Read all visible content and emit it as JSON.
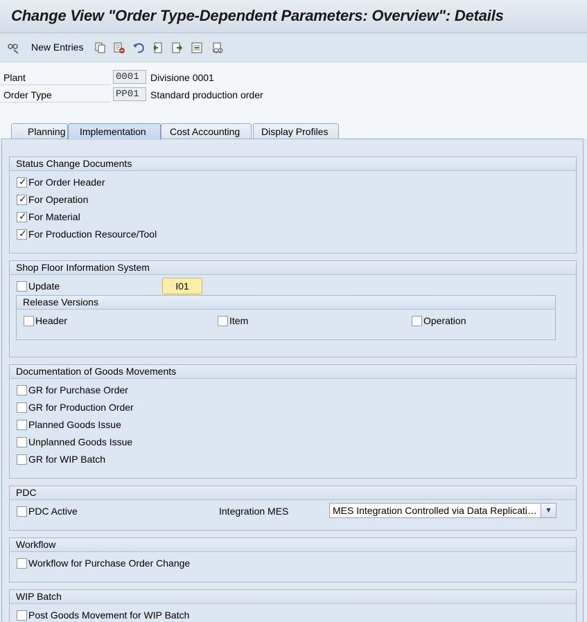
{
  "window": {
    "title": "Change View \"Order Type-Dependent Parameters: Overview\": Details"
  },
  "toolbar": {
    "new_entries_label": "New Entries",
    "icons": [
      "display-change-icon",
      "copy-icon",
      "delete-icon",
      "undo-icon",
      "previous-entry-icon",
      "next-entry-icon",
      "select-block-icon",
      "other-entry-icon"
    ]
  },
  "header": {
    "plant_label": "Plant",
    "plant_value": "0001",
    "plant_desc": "Divisione 0001",
    "order_type_label": "Order Type",
    "order_type_value": "PP01",
    "order_type_desc": "Standard production order"
  },
  "tabs": [
    {
      "label": "Planning",
      "active": false
    },
    {
      "label": "Implementation",
      "active": true
    },
    {
      "label": "Cost Accounting",
      "active": false
    },
    {
      "label": "Display Profiles",
      "active": false
    }
  ],
  "status_change": {
    "title": "Status Change Documents",
    "items": [
      {
        "label": "For Order Header",
        "checked": true
      },
      {
        "label": "For Operation",
        "checked": true
      },
      {
        "label": "For Material",
        "checked": true
      },
      {
        "label": "For Production Resource/Tool",
        "checked": true
      }
    ]
  },
  "shop_floor": {
    "title": "Shop Floor Information System",
    "update_label": "Update",
    "update_checked": false,
    "button_label": "I01",
    "release_versions": {
      "title": "Release Versions",
      "header_label": "Header",
      "item_label": "Item",
      "operation_label": "Operation"
    }
  },
  "goods_movements": {
    "title": "Documentation of Goods Movements",
    "items": [
      {
        "label": "GR for Purchase Order",
        "checked": false
      },
      {
        "label": "GR for Production Order",
        "checked": false
      },
      {
        "label": "Planned Goods Issue",
        "checked": false
      },
      {
        "label": "Unplanned Goods Issue",
        "checked": false
      },
      {
        "label": "GR for WIP Batch",
        "checked": false
      }
    ]
  },
  "pdc": {
    "title": "PDC",
    "active_label": "PDC Active",
    "integration_label": "Integration MES",
    "integration_value": "MES Integration Controlled via Data Replicatio..."
  },
  "workflow": {
    "title": "Workflow",
    "item_label": "Workflow for Purchase Order Change"
  },
  "wip_batch": {
    "title": "WIP Batch",
    "item_label": "Post Goods Movement for WIP Batch"
  },
  "colors": {
    "accent_yellow": "#fbeea6",
    "panel_bg": "#dde7f1"
  }
}
